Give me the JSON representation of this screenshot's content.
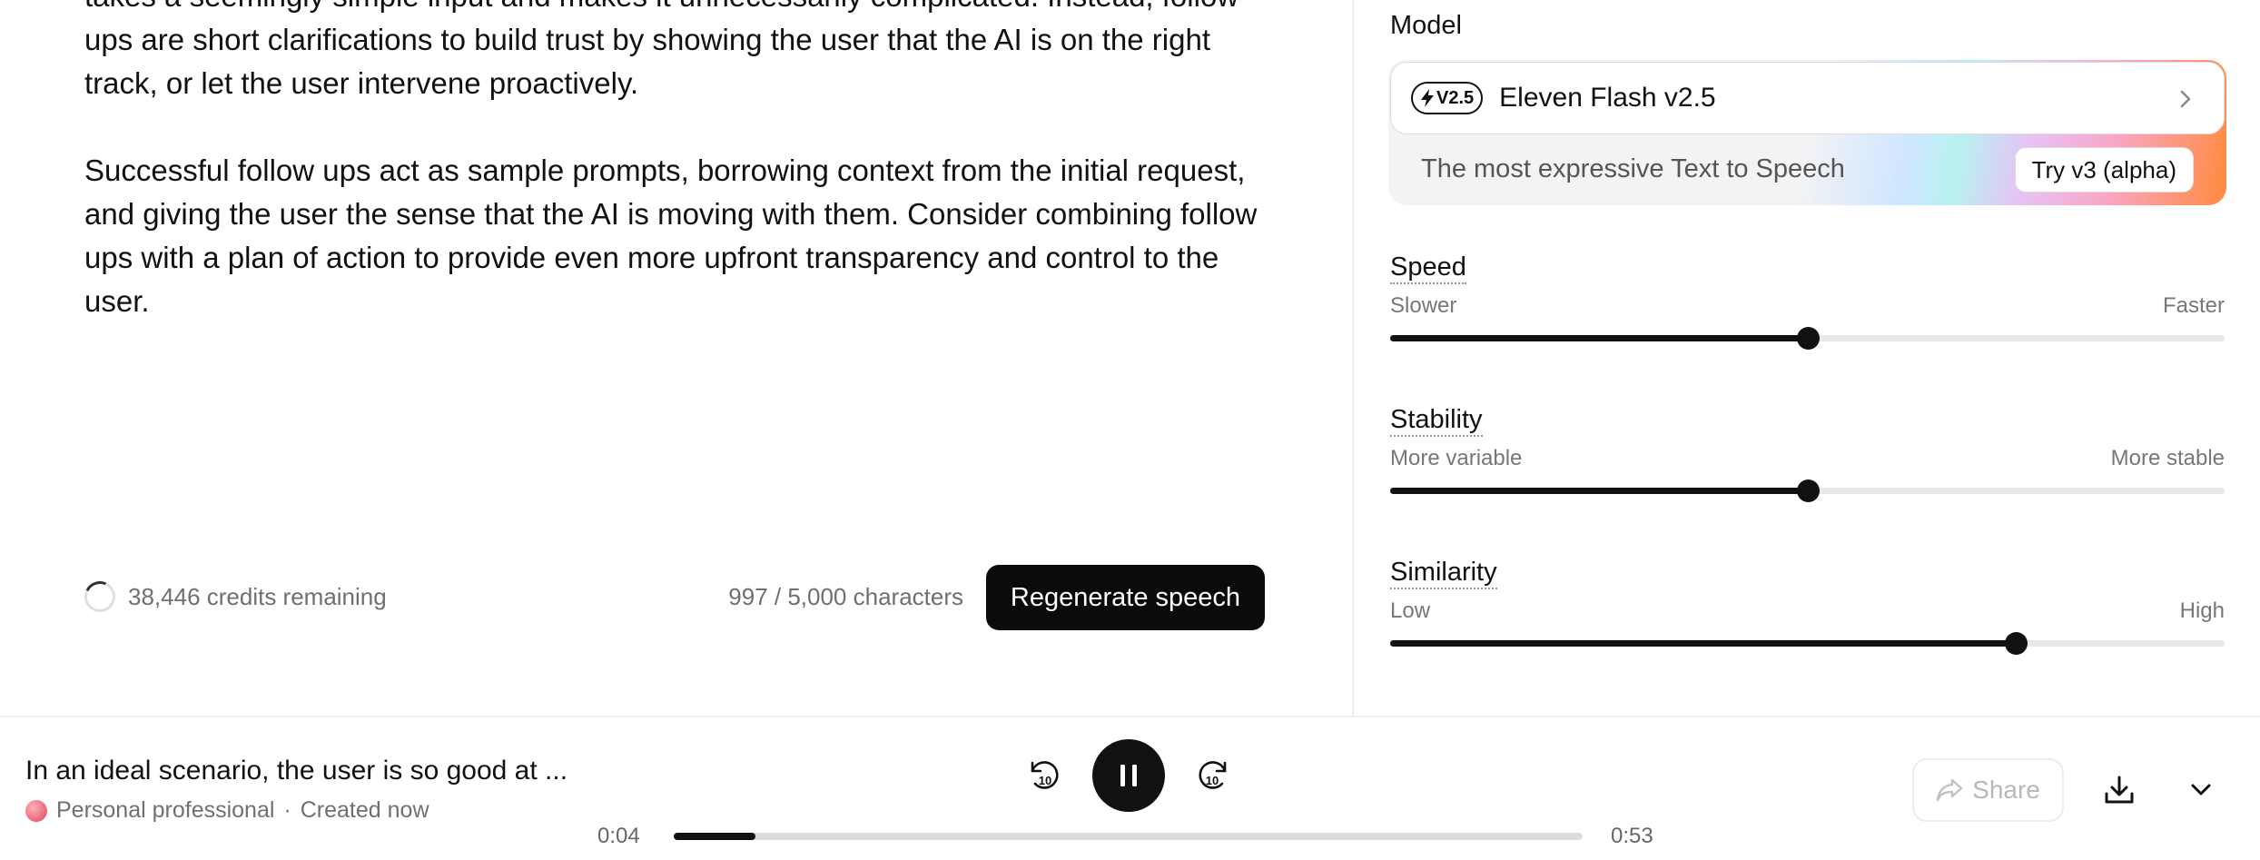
{
  "editor": {
    "paragraphs": [
      "takes a seemingly simple input and makes it unnecessarily complicated. Instead, follow ups are short clarifications to build trust by showing the user that the AI is on the right track, or let the user intervene proactively.",
      "Successful follow ups act as sample prompts, borrowing context from the initial request, and giving the user the sense that the AI is moving with them. Consider combining follow ups with a plan of action to provide even more upfront transparency and control to the user."
    ]
  },
  "footer": {
    "credits": "38,446 credits remaining",
    "char_count": "997 / 5,000 characters",
    "regenerate_label": "Regenerate speech"
  },
  "settings": {
    "model_label": "Model",
    "model": {
      "badge": "V2.5",
      "name": "Eleven Flash v2.5",
      "promo_text": "The most expressive Text to Speech",
      "promo_button": "Try v3 (alpha)"
    },
    "sliders": [
      {
        "title": "Speed",
        "min_label": "Slower",
        "max_label": "Faster",
        "value": 0.5
      },
      {
        "title": "Stability",
        "min_label": "More variable",
        "max_label": "More stable",
        "value": 0.5
      },
      {
        "title": "Similarity",
        "min_label": "Low",
        "max_label": "High",
        "value": 0.75
      }
    ]
  },
  "player": {
    "title": "In an ideal scenario, the user is so good at ...",
    "voice": "Personal professional",
    "separator": "·",
    "created": "Created now",
    "current_time": "0:04",
    "total_time": "0:53",
    "progress": 0.09,
    "skip_back_label": "10",
    "skip_forward_label": "10",
    "share_label": "Share"
  }
}
